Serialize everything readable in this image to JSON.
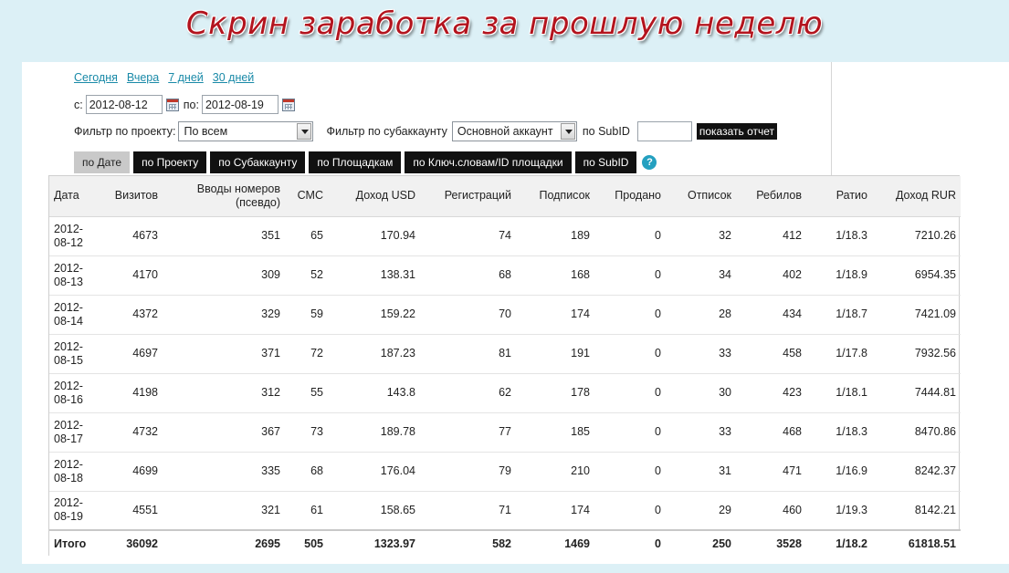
{
  "banner": {
    "title": "Скрин заработка за прошлую неделю"
  },
  "quick_links": [
    "Сегодня",
    "Вчера",
    "7 дней",
    "30 дней"
  ],
  "date_range": {
    "from_label": "с:",
    "from_value": "2012-08-12",
    "to_label": "по:",
    "to_value": "2012-08-19"
  },
  "filters": {
    "project_label": "Фильтр по проекту:",
    "project_value": "По всем",
    "subaccount_label": "Фильтр по субаккаунту",
    "subaccount_value": "Основной аккаунт",
    "subid_label": "по SubID",
    "subid_value": "",
    "show_button": "показать отчет"
  },
  "tabs": [
    {
      "label": "по Дате",
      "active": true
    },
    {
      "label": "по Проекту",
      "active": false
    },
    {
      "label": "по Субаккаунту",
      "active": false
    },
    {
      "label": "по Площадкам",
      "active": false
    },
    {
      "label": "по Ключ.словам/ID площадки",
      "active": false
    },
    {
      "label": "по SubID",
      "active": false
    }
  ],
  "help_icon": {
    "glyph": "?"
  },
  "table": {
    "columns": [
      "Дата",
      "Визитов",
      "Вводы номеров (псевдо)",
      "СМС",
      "Доход USD",
      "Регистраций",
      "Подписок",
      "Продано",
      "Отписок",
      "Ребилов",
      "Ратио",
      "Доход RUR"
    ],
    "rows": [
      [
        "2012-08-12",
        "4673",
        "351",
        "65",
        "170.94",
        "74",
        "189",
        "0",
        "32",
        "412",
        "1/18.3",
        "7210.26"
      ],
      [
        "2012-08-13",
        "4170",
        "309",
        "52",
        "138.31",
        "68",
        "168",
        "0",
        "34",
        "402",
        "1/18.9",
        "6954.35"
      ],
      [
        "2012-08-14",
        "4372",
        "329",
        "59",
        "159.22",
        "70",
        "174",
        "0",
        "28",
        "434",
        "1/18.7",
        "7421.09"
      ],
      [
        "2012-08-15",
        "4697",
        "371",
        "72",
        "187.23",
        "81",
        "191",
        "0",
        "33",
        "458",
        "1/17.8",
        "7932.56"
      ],
      [
        "2012-08-16",
        "4198",
        "312",
        "55",
        "143.8",
        "62",
        "178",
        "0",
        "30",
        "423",
        "1/18.1",
        "7444.81"
      ],
      [
        "2012-08-17",
        "4732",
        "367",
        "73",
        "189.78",
        "77",
        "185",
        "0",
        "33",
        "468",
        "1/18.3",
        "8470.86"
      ],
      [
        "2012-08-18",
        "4699",
        "335",
        "68",
        "176.04",
        "79",
        "210",
        "0",
        "31",
        "471",
        "1/16.9",
        "8242.37"
      ],
      [
        "2012-08-19",
        "4551",
        "321",
        "61",
        "158.65",
        "71",
        "174",
        "0",
        "29",
        "460",
        "1/19.3",
        "8142.21"
      ]
    ],
    "totals": [
      "Итого",
      "36092",
      "2695",
      "505",
      "1323.97",
      "582",
      "1469",
      "0",
      "250",
      "3528",
      "1/18.2",
      "61818.51"
    ]
  }
}
